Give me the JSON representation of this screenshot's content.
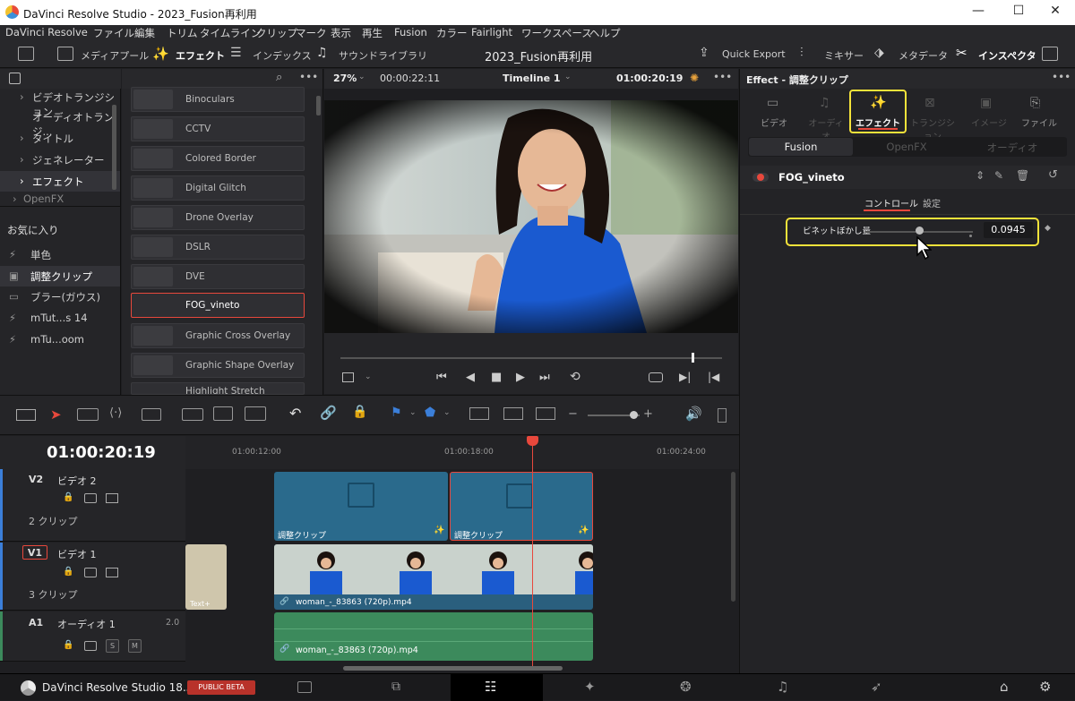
{
  "window": {
    "title": "DaVinci Resolve Studio - 2023_Fusion再利用",
    "min": "—",
    "max": "☐",
    "close": "✕"
  },
  "menu": [
    "DaVinci Resolve",
    "ファイル",
    "編集",
    "トリム",
    "タイムライン",
    "クリップ",
    "マーク",
    "表示",
    "再生",
    "Fusion",
    "カラー",
    "Fairlight",
    "ワークスペース",
    "ヘルプ"
  ],
  "toolbar": {
    "media_pool": "メディアプール",
    "effects": "エフェクト",
    "index": "インデックス",
    "sound_library": "サウンドライブラリ",
    "project_title": "2023_Fusion再利用",
    "quick_export": "Quick Export",
    "mixer": "ミキサー",
    "metadata": "メタデータ",
    "inspector": "インスペクタ"
  },
  "library": {
    "items": [
      {
        "label": "ビデオトランジション",
        "indent": 1
      },
      {
        "label": "オーディオトランジ...",
        "indent": 2
      },
      {
        "label": "タイトル",
        "indent": 1
      },
      {
        "label": "ジェネレーター",
        "indent": 1
      },
      {
        "label": "エフェクト",
        "indent": 1
      },
      {
        "label": "OpenFX",
        "indent": 1
      }
    ],
    "favorites_label": "お気に入り",
    "favorites": [
      {
        "label": "単色",
        "icon": "⚡"
      },
      {
        "label": "調整クリップ",
        "icon": "▣"
      },
      {
        "label": "ブラー(ガウス)",
        "icon": "▭"
      },
      {
        "label": "mTut...s 14",
        "icon": "⚡"
      },
      {
        "label": "mTu...oom",
        "icon": "⚡"
      }
    ]
  },
  "effects_list": [
    "Binoculars",
    "CCTV",
    "Colored Border",
    "Digital Glitch",
    "Drone Overlay",
    "DSLR",
    "DVE",
    "FOG_vineto",
    "Graphic Cross Overlay",
    "Graphic Shape Overlay",
    "Highlight Stretch"
  ],
  "viewer": {
    "zoom": "27%",
    "duration": "00:00:22:11",
    "timeline_name": "Timeline 1",
    "timecode": "01:00:20:19"
  },
  "inspector": {
    "header": "Effect - 調整クリップ",
    "tabs": [
      "ビデオ",
      "オーディオ",
      "エフェクト",
      "トランジション",
      "イメージ",
      "ファイル"
    ],
    "subtabs": [
      "Fusion",
      "OpenFX",
      "オーディオ"
    ],
    "effect_name": "FOG_vineto",
    "ctrl_tabs": [
      "コントロール",
      "設定"
    ],
    "param_label": "ビネットぼかし量",
    "param_value": "0.0945",
    "param_level": 0.5
  },
  "timeline": {
    "timecode": "01:00:20:19",
    "ruler": [
      "01:00:12:00",
      "01:00:18:00",
      "01:00:24:00"
    ],
    "tracks": [
      {
        "id": "V2",
        "name": "ビデオ 2",
        "count": "2 クリップ"
      },
      {
        "id": "V1",
        "name": "ビデオ 1",
        "count": "3 クリップ"
      },
      {
        "id": "A1",
        "name": "オーディオ 1",
        "count": "2.0"
      }
    ],
    "clips": {
      "adj1": "調整クリップ",
      "adj2": "調整クリップ",
      "video": "woman_-_83863 (720p).mp4",
      "text": "Text+",
      "audio": "woman_-_83863 (720p).mp4"
    },
    "audio_buttons": {
      "s": "S",
      "m": "M"
    }
  },
  "bottom": {
    "app": "DaVinci Resolve Studio 18.5",
    "badge": "PUBLIC BETA"
  },
  "colors": {
    "accent_red": "#e8483c",
    "highlight_yellow": "#f5e33a",
    "video_clip": "#2a6a8c",
    "audio_clip": "#3c8a5c"
  }
}
